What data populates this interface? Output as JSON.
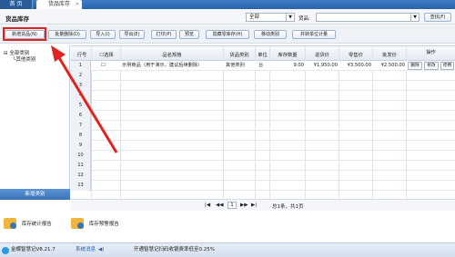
{
  "tabs": [
    {
      "label": "首 页"
    },
    {
      "label": "货品库存"
    }
  ],
  "page_title": "货品库存",
  "filter": {
    "category_select": "全部",
    "goods_label": "货品:",
    "goods_input": "",
    "search_button": "查找(F)"
  },
  "toolbar": {
    "buttons": [
      "新增货品(N)",
      "批量删除(D)",
      "导入(I)",
      "导出(E)",
      "打印(P)",
      "预览",
      "隐藏零库存(H)",
      "移动类别",
      "并转单位计量"
    ]
  },
  "tree": {
    "root": "全部类别",
    "child": "其他类别",
    "new_category_button": "新增类别"
  },
  "grid": {
    "columns": [
      "行号",
      "选择",
      "品名规格",
      "货品类别",
      "单位",
      "库存数量",
      "进货价",
      "零售价",
      "批发价",
      "操作"
    ],
    "row1": {
      "name": "示例商品（用于演示，建议后续删除）",
      "category": "其他类别",
      "unit": "台",
      "stock": "9.00",
      "purchase": "¥1,950.00",
      "retail": "¥3,500.00",
      "wholesale": "¥2,500.00",
      "actions": [
        "删除",
        "修改",
        "停用"
      ]
    },
    "row_numbers": [
      "1",
      "2",
      "3",
      "4",
      "5",
      "6",
      "7",
      "8",
      "9",
      "10",
      "11",
      "12",
      "13"
    ]
  },
  "pager": {
    "first": "|◀",
    "prev": "◀◀",
    "page": "1",
    "next": "▶▶",
    "last": "▶|",
    "summary": "总1条，共1页"
  },
  "reports": [
    {
      "label": "库存统计报告"
    },
    {
      "label": "库存预警报告"
    }
  ],
  "status": {
    "app": "金蝶智慧记V8.21.7",
    "news": "系统消息",
    "ticker": "开通智慧记扫码收银费率低至0.25%"
  },
  "colors": {
    "accent": "#3b72b8",
    "highlight": "#e0231e"
  }
}
